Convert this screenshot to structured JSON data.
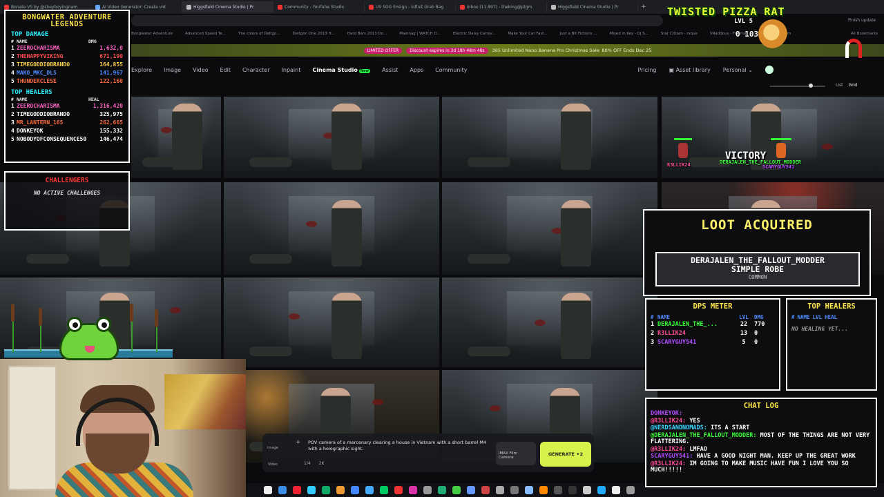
{
  "browser": {
    "tabs": [
      {
        "label": "Bonate VS by @sheyboyingnam",
        "color": "#e33"
      },
      {
        "label": "AI Video Generator: Create vid",
        "color": "#6af"
      },
      {
        "label": "Higgsfield Cinema Studio | Pr",
        "color": "#bbb"
      },
      {
        "label": "Community - YouTube Studio",
        "color": "#e33"
      },
      {
        "label": "US SOG Ensign - Infinit Grab Bag",
        "color": "#e33"
      },
      {
        "label": "Inbox (11,897) - theking@ptgm",
        "color": "#e33"
      },
      {
        "label": "Higgsfield Cinema Studio | Pr",
        "color": "#bbb"
      }
    ],
    "update_label": "Finish update",
    "bookmarks": [
      "Bongwater Adventure",
      "Advanced Speed Te...",
      "The colors of Deltgo...",
      "Deltgon One 2013 H...",
      "Hard Bars 2013 Do...",
      "Mainnag | WATCH D...",
      "Electric Daisy Carniv...",
      "Make Your Car Fast...",
      "Just a Bit Fictions ...",
      "Mixed in Key - Dj S...",
      "Star Citizen - rsque",
      "VRaddous - Fishma...",
      "Bonobo 3d mm"
    ],
    "all_bookmarks": "All Bookmarks"
  },
  "promo": {
    "offer_label": "LIMITED OFFER",
    "expires_label": "Discount expires in 3d 18h 48m 48s",
    "text": "365 Unlimited Nano Banana Pro Christmas Sale: 80% OFF Ends Dec 25"
  },
  "nav": {
    "items": [
      "Explore",
      "Image",
      "Video",
      "Edit",
      "Character",
      "Inpaint",
      "Cinema Studio",
      "Assist",
      "Apps",
      "Community"
    ],
    "active_index": 6,
    "new_badge": "New",
    "pricing": "Pricing",
    "asset_library": "Asset library",
    "workspace": "Personal"
  },
  "view": {
    "list": "List",
    "grid": "Grid"
  },
  "prompt": {
    "text": "POV camera of a mercenary clearing a house in Vietnam with a short barrel M4 with a holographic sight.",
    "count": "1/4",
    "resolution": "2K",
    "camera": "IMAX Film Camera",
    "generate_label": "GENERATE",
    "generate_cost": "2",
    "side_image": "Image",
    "side_video": "Video"
  },
  "bongwater": {
    "title": "BONGWATER ADVENTURE LEGENDS",
    "top_damage_label": "TOP DAMAGE",
    "col_name": "NAME",
    "col_dmg": "DMG",
    "col_heal": "HEAL",
    "top_damage": [
      {
        "rank": "1",
        "name": "ZEEROCHARISMA",
        "value": "1,632,0",
        "color": "#ff66c4"
      },
      {
        "rank": "2",
        "name": "THEHAPPYVIKING",
        "value": "671,190",
        "color": "#ff4d4d"
      },
      {
        "rank": "3",
        "name": "TIMEGODDIOBRANDO",
        "value": "164,855",
        "color": "#ffd14d"
      },
      {
        "rank": "4",
        "name": "MAKO_MKC_DLS",
        "value": "141,967",
        "color": "#4d8bff"
      },
      {
        "rank": "5",
        "name": "THUNDERCLESE",
        "value": "122,160",
        "color": "#ff6b3d"
      }
    ],
    "top_healers_label": "TOP HEALERS",
    "top_healers": [
      {
        "rank": "1",
        "name": "ZEEROCHARISMA",
        "value": "1,316,420",
        "color": "#ff66c4"
      },
      {
        "rank": "2",
        "name": "TIMEGODDIOBRANDO",
        "value": "325,975",
        "color": "#ffffff"
      },
      {
        "rank": "3",
        "name": "MR_LANTERN_165",
        "value": "262,665",
        "color": "#ff6b3d"
      },
      {
        "rank": "4",
        "name": "DONKEYOK",
        "value": "155,332",
        "color": "#ffffff"
      },
      {
        "rank": "5",
        "name": "NOBODYOFCONSEQUENCE50",
        "value": "146,474",
        "color": "#ffffff"
      }
    ]
  },
  "challengers": {
    "title": "CHALLENGERS",
    "empty": "NO ACTIVE CHALLENGES"
  },
  "rat": {
    "title": "TWISTED PIZZA RAT",
    "level": "LVL 5",
    "gold": "0  103"
  },
  "battle": {
    "victory": "VICTORY",
    "names": [
      "R3LLIK24",
      "DERAJALEN_THE_FALLOUT_MODDER",
      "SCARYGUY541"
    ]
  },
  "loot": {
    "title": "LOOT ACQUIRED",
    "user": "DERAJALEN_THE_FALLOUT_MODDER",
    "item": "SIMPLE ROBE",
    "rarity": "COMMON"
  },
  "dps": {
    "title": "DPS METER",
    "cols": [
      "#",
      "NAME",
      "LVL",
      "DMG"
    ],
    "rows": [
      {
        "rank": "1",
        "name": "DERAJALEN_THE_...",
        "lvl": "22",
        "dmg": "770",
        "color": "#3dff3d"
      },
      {
        "rank": "2",
        "name": "R3LLIK24",
        "lvl": "13",
        "dmg": "0",
        "color": "#ff4d9a"
      },
      {
        "rank": "3",
        "name": "SCARYGUY541",
        "lvl": "5",
        "dmg": "0",
        "color": "#b44dff"
      }
    ]
  },
  "healers": {
    "title": "TOP HEALERS",
    "cols": [
      "#",
      "NAME",
      "LVL",
      "HEAL"
    ],
    "empty": "NO HEALING YET..."
  },
  "chat": {
    "title": "CHAT LOG",
    "messages": [
      {
        "user": "DONKEYOK:",
        "text": "",
        "color": "#b44dff"
      },
      {
        "user": "@R3LLIK24:",
        "text": "YES",
        "color": "#ff4d9a"
      },
      {
        "user": "@NERDSANDNOMADS:",
        "text": "ITS A START",
        "color": "#3dd6ff"
      },
      {
        "user": "@DERAJALEN_THE_FALLOUT_MODDER:",
        "text": "MOST OF THE THINGS ARE NOT VERY FLATTERING.",
        "color": "#3dff3d"
      },
      {
        "user": "@R3LLIK24:",
        "text": "LMFAO",
        "color": "#ff4d9a"
      },
      {
        "user": "SCARYGUY541:",
        "text": "HAVE A GOOD NIGHT MAN. KEEP UP THE GREAT WORK",
        "color": "#b44dff"
      },
      {
        "user": "@R3LLIK24:",
        "text": "IM GOING TO MAKE MUSIC HAVE FUN I LOVE YOU SO MUCH!!!!!",
        "color": "#ff4d9a"
      }
    ]
  }
}
